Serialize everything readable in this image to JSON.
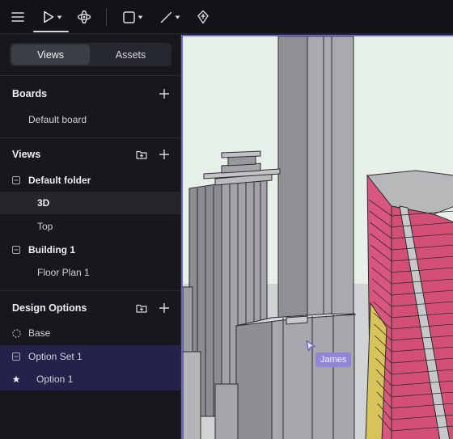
{
  "toolbar": {
    "items": [
      "menu-icon",
      "select-tool-icon",
      "orbit-icon",
      "rectangle-tool-icon",
      "line-tool-icon",
      "pin-tool-icon"
    ],
    "active_tool": "select-tool-icon"
  },
  "sidebar": {
    "tabs": [
      {
        "label": "Views",
        "active": true
      },
      {
        "label": "Assets",
        "active": false
      }
    ],
    "boards": {
      "title": "Boards",
      "items": [
        {
          "label": "Default board"
        }
      ]
    },
    "views": {
      "title": "Views",
      "folders": [
        {
          "label": "Default folder",
          "items": [
            {
              "label": "3D",
              "selected": true
            },
            {
              "label": "Top"
            }
          ]
        },
        {
          "label": "Building 1",
          "items": [
            {
              "label": "Floor Plan 1"
            }
          ]
        }
      ]
    },
    "design_options": {
      "title": "Design Options",
      "base": {
        "label": "Base"
      },
      "option_set": {
        "label": "Option Set 1"
      },
      "option": {
        "label": "Option 1"
      }
    }
  },
  "viewport": {
    "cursor_label": "James",
    "colors": {
      "sky": "#e7efe9",
      "concrete": "#8d8f92",
      "accent_pink": "#d9577e",
      "accent_yellow": "#d8c25a",
      "selection": "#6b63c9"
    }
  }
}
